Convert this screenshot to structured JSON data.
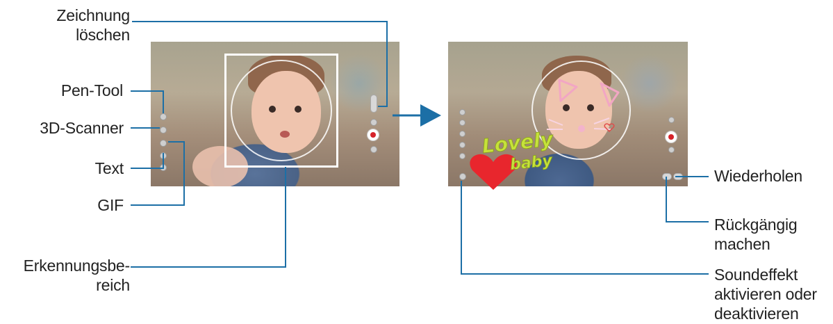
{
  "labels": {
    "clear_drawing": [
      "Zeichnung",
      "löschen"
    ],
    "pen_tool": "Pen-Tool",
    "scanner_3d": "3D-Scanner",
    "text": "Text",
    "gif": "GIF",
    "recognition_area": [
      "Erkennungsbe-",
      "reich"
    ],
    "redo": "Wiederholen",
    "undo": [
      "Rückgängig",
      "machen"
    ],
    "sound_effect": [
      "Soundeffekt",
      "aktivieren oder",
      "deaktivieren"
    ]
  },
  "drawing_text": {
    "line1": "Lovely",
    "line2": "baby"
  },
  "icons": {
    "arrow": "arrow-right-icon",
    "pen": "pen-icon",
    "scanner": "3d-scanner-icon",
    "text": "text-icon",
    "gif": "gif-icon",
    "clear": "clear-drawing-icon",
    "shutter": "shutter-icon",
    "sound": "sound-icon",
    "undo": "undo-icon",
    "redo": "redo-icon"
  },
  "colors": {
    "accent_line": "#1c6fa6",
    "shutter_red": "#d6232a",
    "drawing_green": "#c6e23a",
    "drawing_heart": "#e8262d",
    "cat_ears": "#f2a6c4"
  }
}
